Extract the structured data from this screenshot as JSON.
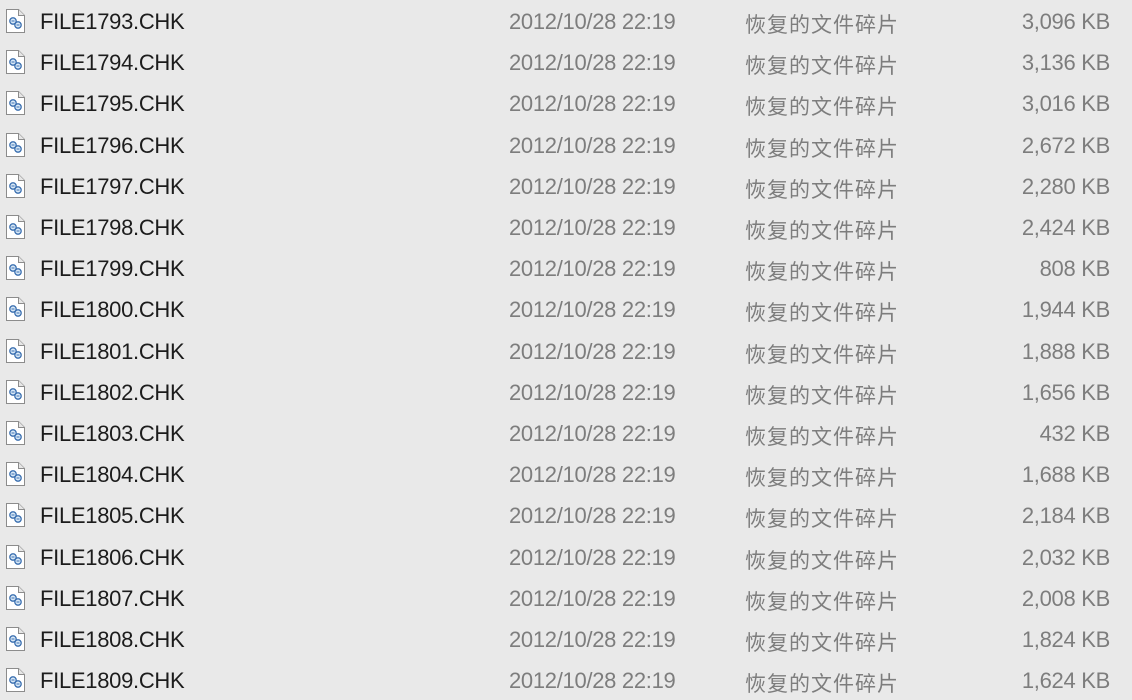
{
  "file_list": {
    "icon": "chk-file-icon",
    "rows": [
      {
        "name": "FILE1793.CHK",
        "modified": "2012/10/28 22:19",
        "type": "恢复的文件碎片",
        "size": "3,096 KB"
      },
      {
        "name": "FILE1794.CHK",
        "modified": "2012/10/28 22:19",
        "type": "恢复的文件碎片",
        "size": "3,136 KB"
      },
      {
        "name": "FILE1795.CHK",
        "modified": "2012/10/28 22:19",
        "type": "恢复的文件碎片",
        "size": "3,016 KB"
      },
      {
        "name": "FILE1796.CHK",
        "modified": "2012/10/28 22:19",
        "type": "恢复的文件碎片",
        "size": "2,672 KB"
      },
      {
        "name": "FILE1797.CHK",
        "modified": "2012/10/28 22:19",
        "type": "恢复的文件碎片",
        "size": "2,280 KB"
      },
      {
        "name": "FILE1798.CHK",
        "modified": "2012/10/28 22:19",
        "type": "恢复的文件碎片",
        "size": "2,424 KB"
      },
      {
        "name": "FILE1799.CHK",
        "modified": "2012/10/28 22:19",
        "type": "恢复的文件碎片",
        "size": "808 KB"
      },
      {
        "name": "FILE1800.CHK",
        "modified": "2012/10/28 22:19",
        "type": "恢复的文件碎片",
        "size": "1,944 KB"
      },
      {
        "name": "FILE1801.CHK",
        "modified": "2012/10/28 22:19",
        "type": "恢复的文件碎片",
        "size": "1,888 KB"
      },
      {
        "name": "FILE1802.CHK",
        "modified": "2012/10/28 22:19",
        "type": "恢复的文件碎片",
        "size": "1,656 KB"
      },
      {
        "name": "FILE1803.CHK",
        "modified": "2012/10/28 22:19",
        "type": "恢复的文件碎片",
        "size": "432 KB"
      },
      {
        "name": "FILE1804.CHK",
        "modified": "2012/10/28 22:19",
        "type": "恢复的文件碎片",
        "size": "1,688 KB"
      },
      {
        "name": "FILE1805.CHK",
        "modified": "2012/10/28 22:19",
        "type": "恢复的文件碎片",
        "size": "2,184 KB"
      },
      {
        "name": "FILE1806.CHK",
        "modified": "2012/10/28 22:19",
        "type": "恢复的文件碎片",
        "size": "2,032 KB"
      },
      {
        "name": "FILE1807.CHK",
        "modified": "2012/10/28 22:19",
        "type": "恢复的文件碎片",
        "size": "2,008 KB"
      },
      {
        "name": "FILE1808.CHK",
        "modified": "2012/10/28 22:19",
        "type": "恢复的文件碎片",
        "size": "1,824 KB"
      },
      {
        "name": "FILE1809.CHK",
        "modified": "2012/10/28 22:19",
        "type": "恢复的文件碎片",
        "size": "1,624 KB"
      }
    ]
  }
}
